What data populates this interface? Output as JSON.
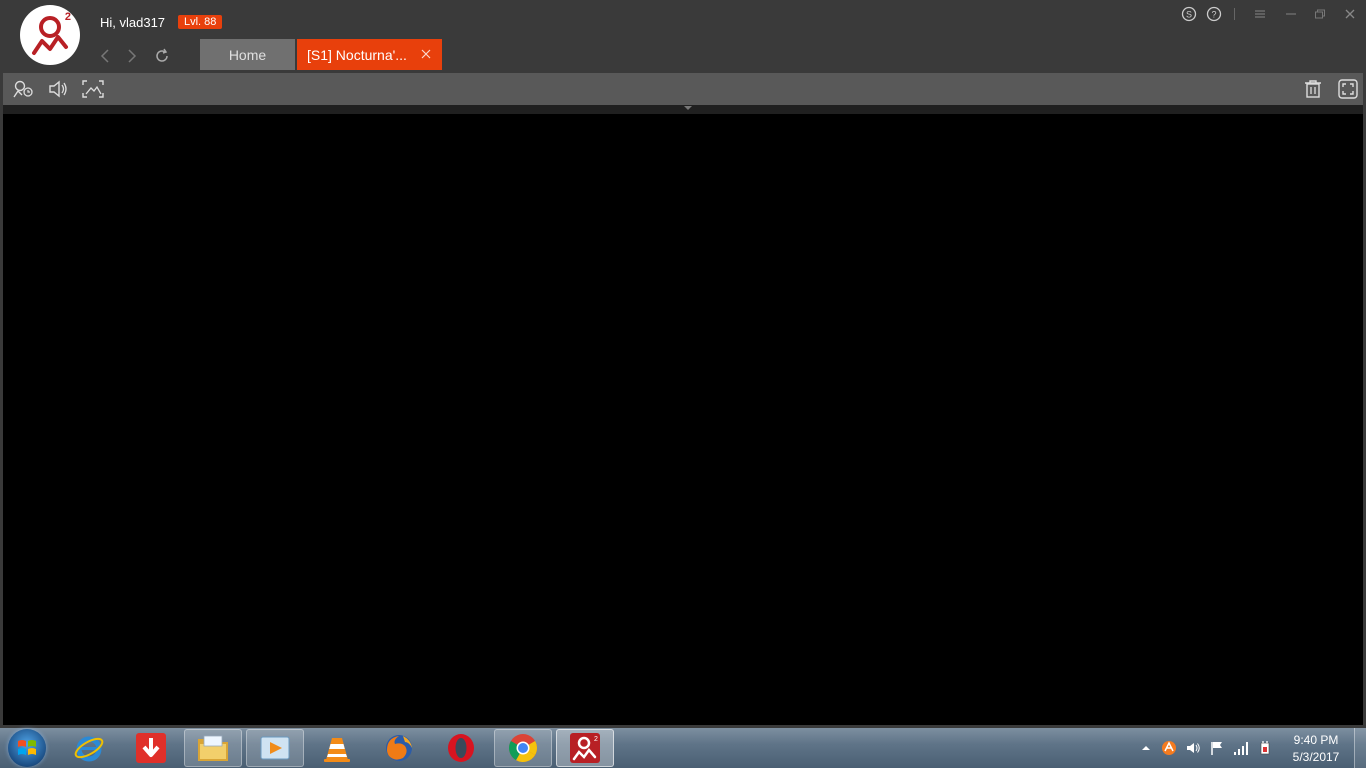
{
  "app": {
    "logo_superscript": "2",
    "greeting": "Hi, vlad317",
    "level": "Lvl. 88"
  },
  "tabs": [
    {
      "label": "Home",
      "active": false
    },
    {
      "label": "[S1] Nocturna'...",
      "active": true
    }
  ],
  "window_controls": [
    "skype-icon",
    "help-icon",
    "menu-icon",
    "minimize-icon",
    "restore-icon",
    "close-icon"
  ],
  "toolbar": {
    "left": [
      "profile-icon",
      "sound-icon",
      "screenshot-icon"
    ],
    "right": [
      "trash-icon",
      "fullscreen-icon"
    ]
  },
  "taskbar": {
    "pinned": [
      "internet-explorer-icon",
      "idm-icon",
      "file-explorer-icon",
      "media-player-icon",
      "vlc-icon",
      "firefox-icon",
      "opera-icon",
      "chrome-icon",
      "app-icon"
    ],
    "clock_time": "9:40 PM",
    "clock_date": "5/3/2017"
  },
  "colors": {
    "accent": "#e8400c",
    "titlebar": "#3a3a3a",
    "toolbar": "#595959",
    "game_background": "#000000",
    "brand_red": "#b82025"
  }
}
